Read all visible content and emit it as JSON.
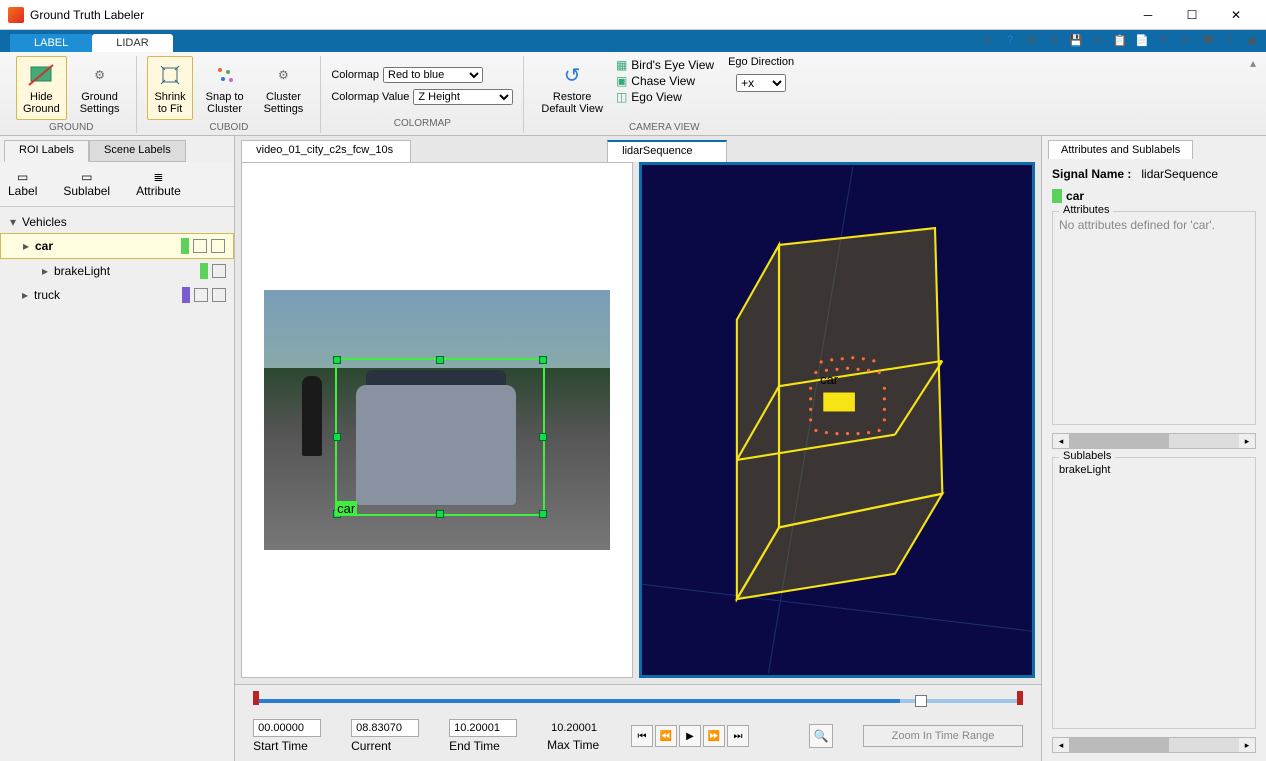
{
  "window": {
    "title": "Ground Truth Labeler"
  },
  "tabs": {
    "label": "LABEL",
    "lidar": "LIDAR"
  },
  "ribbon": {
    "ground": {
      "title": "GROUND",
      "hideGround": "Hide\nGround",
      "groundSettings": "Ground\nSettings"
    },
    "cuboid": {
      "title": "CUBOID",
      "shrink": "Shrink\nto Fit",
      "snap": "Snap to\nCluster",
      "cluster": "Cluster\nSettings"
    },
    "colormap": {
      "title": "COLORMAP",
      "colormapLabel": "Colormap",
      "colormapValue": "Red to blue",
      "colormapValLabel": "Colormap Value",
      "colormapValValue": "Z Height"
    },
    "cameraview": {
      "title": "CAMERA VIEW",
      "restore": "Restore\nDefault View",
      "birdseye": "Bird's Eye View",
      "chase": "Chase View",
      "ego": "Ego View",
      "egodir": "Ego Direction",
      "egodirVal": "+x"
    }
  },
  "left": {
    "roiTab": "ROI Labels",
    "sceneTab": "Scene Labels",
    "labelBtn": "Label",
    "sublabelBtn": "Sublabel",
    "attrBtn": "Attribute",
    "groupVehicles": "Vehicles",
    "car": "car",
    "brakeLight": "brakeLight",
    "truck": "truck"
  },
  "views": {
    "videoTab": "video_01_city_c2s_fcw_10s",
    "lidarTab": "lidarSequence",
    "carLabel": "car",
    "lidarLabel": "car"
  },
  "timeline": {
    "start": "00.00000",
    "startLbl": "Start Time",
    "current": "08.83070",
    "currentLbl": "Current",
    "end": "10.20001",
    "endLbl": "End Time",
    "max": "10.20001",
    "maxLbl": "Max Time",
    "zoom": "Zoom In Time Range"
  },
  "right": {
    "tab": "Attributes and Sublabels",
    "signalNameLbl": "Signal Name :",
    "signalName": "lidarSequence",
    "selected": "car",
    "attrLegend": "Attributes",
    "noAttr": "No attributes defined for 'car'.",
    "subLegend": "Sublabels",
    "brakeLight": "brakeLight"
  }
}
